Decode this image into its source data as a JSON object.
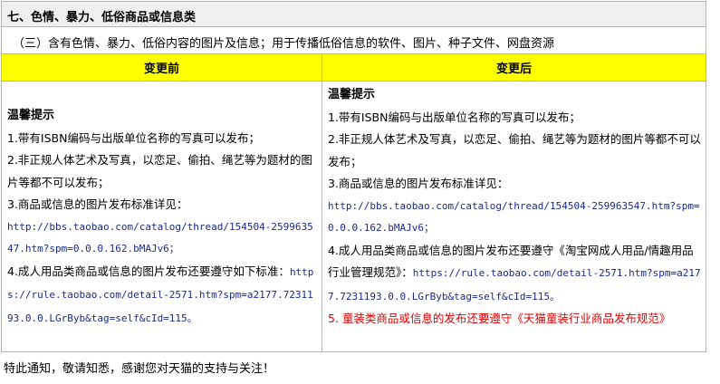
{
  "section_title": "七、色情、暴力、低俗商品或信息类",
  "subtitle": "（三）含有色情、暴力、低俗内容的图片及信息；用于传播低俗信息的软件、图片、种子文件、网盘资源",
  "columns": {
    "before": "变更前",
    "after": "变更后"
  },
  "before": {
    "heading": "温馨提示",
    "item1": "1.带有ISBN编码与出版单位名称的写真可以发布；",
    "item2": "2.非正规人体艺术及写真，以恋足、偷拍、绳艺等为题材的图片等都不可以发布；",
    "item3": "3.商品或信息的图片发布标准详见：",
    "item3_link": "http://bbs.taobao.com/catalog/thread/154504-259963547.htm?spm=0.0.0.162.bMAJv6；",
    "item4_text": "4.成人用品类商品或信息的图片发布还要遵守如下标准：",
    "item4_link": "https://rule.taobao.com/detail-2571.htm?spm=a2177.7231193.0.0.LGrByb&tag=self&cId=115。"
  },
  "after": {
    "heading": "温馨提示",
    "item1": "1.带有ISBN编码与出版单位名称的写真可以发布；",
    "item2": "2.非正规人体艺术及写真，以恋足、偷拍、绳艺等为题材的图片等都不可以发布；",
    "item3": "3.商品或信息的图片发布标准详见：",
    "item3_link": "http://bbs.taobao.com/catalog/thread/154504-259963547.htm?spm=0.0.0.162.bMAJv6；",
    "item4_text": "4.成人用品类商品或信息的图片发布还要遵守《淘宝网成人用品/情趣用品行业管理规范》：",
    "item4_link": "https://rule.taobao.com/detail-2571.htm?spm=a2177.7231193.0.0.LGrByb&tag=self&cId=115。",
    "item5": "5. 童装类商品或信息的发布还要遵守《天猫童装行业商品发布规范》"
  },
  "footer": "特此通知，敬请知悉，感谢您对天猫的支持与关注！",
  "colors": {
    "header_bg": "#ffff00",
    "title_bg": "#efefef",
    "link": "#1a2a8a",
    "notice_red": "#e00000",
    "border": "#b5b5b5"
  }
}
